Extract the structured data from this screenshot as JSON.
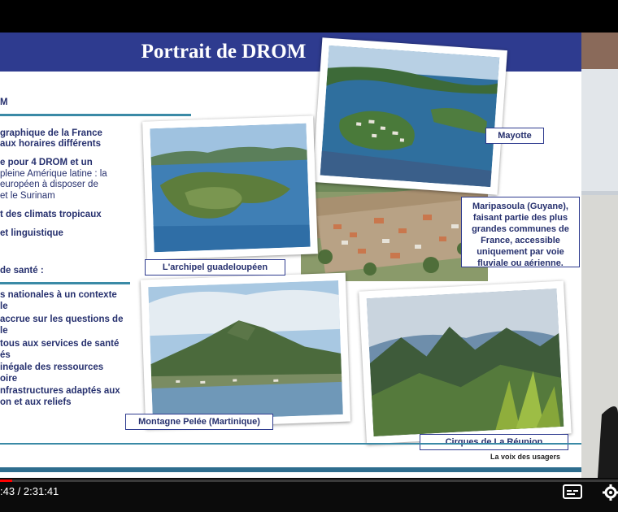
{
  "slide": {
    "title": "Portrait de DROM",
    "left_lines": [
      {
        "text": "M",
        "bold": true
      },
      {
        "text": "graphique  de  la  France",
        "bold": true
      },
      {
        "text": "aux horaires différents",
        "bold": true
      },
      {
        "text": "e   pour  4  DROM  et  un",
        "bold": true
      },
      {
        "text": " pleine Amérique latine : la",
        "bold": false
      },
      {
        "text": " européen  à  disposer  de",
        "bold": false
      },
      {
        "text": "et le Surinam",
        "bold": false
      },
      {
        "text": "t des climats tropicaux",
        "bold": true
      },
      {
        "text": "et linguistique",
        "bold": true
      },
      {
        "text": " de santé :",
        "bold": true
      },
      {
        "text": "s  nationales  à  un  contexte",
        "bold": true
      },
      {
        "text": "le",
        "bold": true
      },
      {
        "text": "accrue sur les questions de",
        "bold": true
      },
      {
        "text": "le",
        "bold": true
      },
      {
        "text": "tous aux services de santé",
        "bold": true
      },
      {
        "text": "és",
        "bold": true
      },
      {
        "text": " inégale  des  ressources",
        "bold": true
      },
      {
        "text": "oire",
        "bold": true
      },
      {
        "text": "nfrastructures adaptés aux",
        "bold": true
      },
      {
        "text": "on et aux reliefs",
        "bold": true
      }
    ],
    "captions": {
      "mayotte": "Mayotte",
      "maripasoula": "Maripasoula (Guyane), faisant partie des plus grandes communes de France, accessible uniquement par voie fluviale ou aérienne.",
      "guadeloupe": "L'archipel guadeloupéen",
      "martinique": "Montagne Pelée (Martinique)",
      "reunion": "Cirques de La Réunion"
    },
    "footer": "La voix des usagers"
  },
  "player": {
    "time": ":43 / 2:31:41",
    "progress": 0.02,
    "accent": "#ff0000"
  },
  "colors": {
    "header": "#2e3b8f",
    "text": "#26306e",
    "rule": "#3a8aa6"
  }
}
